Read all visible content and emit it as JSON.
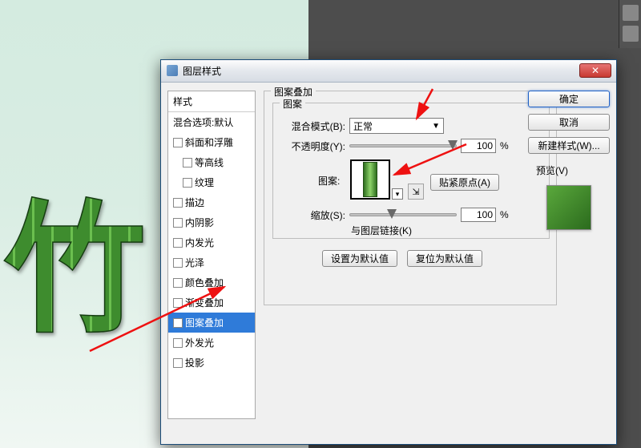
{
  "dialog": {
    "title": "图层样式",
    "styles_header": "样式",
    "blend_options": "混合选项:默认",
    "effects": [
      {
        "label": "斜面和浮雕",
        "checked": false
      },
      {
        "label": "等高线",
        "checked": false,
        "indent": true
      },
      {
        "label": "纹理",
        "checked": false,
        "indent": true
      },
      {
        "label": "描边",
        "checked": false
      },
      {
        "label": "内阴影",
        "checked": false
      },
      {
        "label": "内发光",
        "checked": false
      },
      {
        "label": "光泽",
        "checked": false
      },
      {
        "label": "颜色叠加",
        "checked": false
      },
      {
        "label": "渐变叠加",
        "checked": false
      },
      {
        "label": "图案叠加",
        "checked": true,
        "selected": true
      },
      {
        "label": "外发光",
        "checked": false
      },
      {
        "label": "投影",
        "checked": false
      }
    ],
    "pattern_overlay": {
      "group_title": "图案叠加",
      "inner_title": "图案",
      "blend_mode_label": "混合模式(B):",
      "blend_mode_value": "正常",
      "opacity_label": "不透明度(Y):",
      "opacity_value": "100",
      "opacity_unit": "%",
      "pattern_label": "图案:",
      "snap_origin": "贴紧原点(A)",
      "scale_label": "缩放(S):",
      "scale_value": "100",
      "scale_unit": "%",
      "link_layer": "与图层链接(K)"
    },
    "set_default": "设置为默认值",
    "reset_default": "复位为默认值"
  },
  "buttons": {
    "ok": "确定",
    "cancel": "取消",
    "new_style": "新建样式(W)...",
    "preview": "预览(V)"
  },
  "canvas_text": "竹"
}
